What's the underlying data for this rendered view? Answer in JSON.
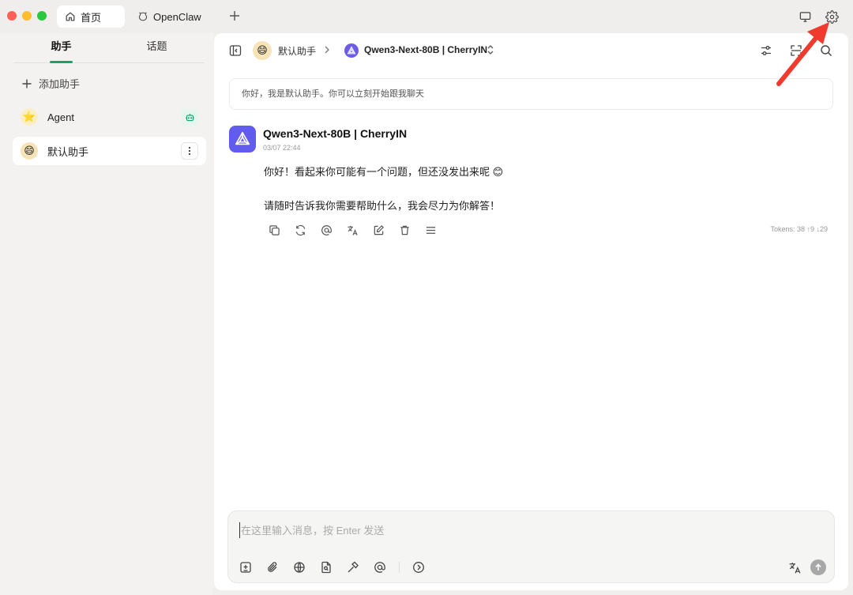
{
  "titlebar": {
    "tabs": [
      {
        "label": "首页",
        "icon": "home-icon",
        "active": true
      },
      {
        "label": "OpenClaw",
        "icon": "claw-icon",
        "active": false
      }
    ],
    "add_tab_icon": "plus-icon",
    "right_icons": [
      "monitor-icon",
      "gear-icon"
    ]
  },
  "sidebar": {
    "tabs": [
      {
        "label": "助手",
        "active": true
      },
      {
        "label": "话题",
        "active": false
      }
    ],
    "add_assistant_label": "添加助手",
    "items": [
      {
        "label": "Agent",
        "avatar": "⭐",
        "badge_icon": "robot-icon"
      },
      {
        "label": "默认助手",
        "avatar": "😄",
        "badge_icon": "more-vertical-icon",
        "selected": true
      }
    ]
  },
  "header": {
    "assistant_name": "默认助手",
    "model_name": "Qwen3-Next-80B | CherryIN",
    "icons": [
      "sidebar-toggle-icon",
      "chevron-right-icon",
      "model-logo-icon",
      "updown-icon",
      "sliders-icon",
      "expand-icon",
      "search-icon"
    ]
  },
  "chat": {
    "greeting": "你好，我是默认助手。你可以立刻开始跟我聊天",
    "message": {
      "model": "Qwen3-Next-80B | CherryIN",
      "time": "03/07 22:44",
      "line1": "你好！看起来你可能有一个问题，但还没发出来呢 😊",
      "line2": "请随时告诉我你需要帮助什么，我会尽力为你解答！",
      "tokens": "Tokens: 38 ↑9 ↓29",
      "actions": [
        "copy-icon",
        "regenerate-icon",
        "mention-icon",
        "translate-icon",
        "edit-icon",
        "delete-icon",
        "menu-icon"
      ]
    }
  },
  "input": {
    "placeholder": "在这里输入消息，按 Enter 发送",
    "value": "",
    "tools": [
      "new-topic-icon",
      "attachment-icon",
      "web-search-icon",
      "file-search-icon",
      "hammer-icon",
      "mention-icon",
      "expand-circle-icon"
    ],
    "right_tools": [
      "translate-icon",
      "send-icon"
    ]
  },
  "colors": {
    "accent": "#16a36a",
    "model_brand": "#615ced",
    "annotation_arrow": "#f03a2e"
  }
}
